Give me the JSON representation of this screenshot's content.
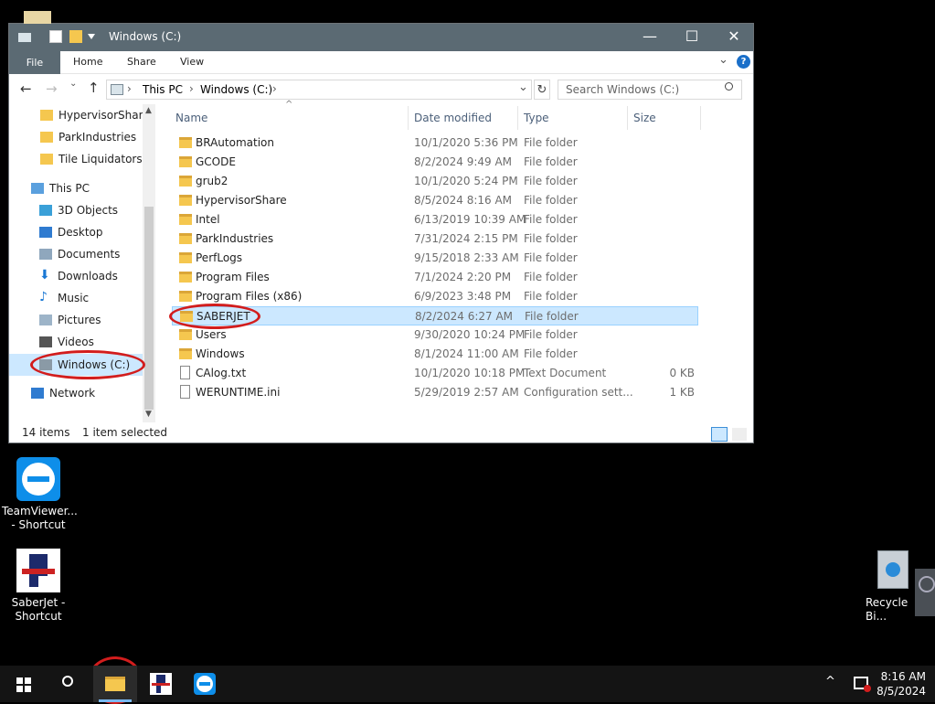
{
  "window": {
    "title": "Windows (C:)",
    "controls": {
      "minimize": "—",
      "maximize": "☐",
      "close": "✕"
    }
  },
  "ribbon": {
    "tabs": [
      "File",
      "Home",
      "Share",
      "View"
    ],
    "expand_chevron": "⌄",
    "help": "?"
  },
  "nav": {
    "back": "←",
    "forward": "→",
    "up": "↑",
    "breadcrumb": [
      "This PC",
      "Windows (C:)"
    ],
    "search_placeholder": "Search Windows (C:)"
  },
  "sidebar": {
    "quick_access": [
      "HypervisorShare",
      "ParkIndustries",
      "Tile Liquidators G"
    ],
    "this_pc": "This PC",
    "this_pc_items": [
      "3D Objects",
      "Desktop",
      "Documents",
      "Downloads",
      "Music",
      "Pictures",
      "Videos",
      "Windows (C:)"
    ],
    "network": "Network"
  },
  "file_list": {
    "columns": {
      "name": "Name",
      "date": "Date modified",
      "type": "Type",
      "size": "Size"
    },
    "rows": [
      {
        "name": "BRAutomation",
        "date": "10/1/2020 5:36 PM",
        "type": "File folder",
        "size": "",
        "icon": "folder-icon"
      },
      {
        "name": "GCODE",
        "date": "8/2/2024 9:49 AM",
        "type": "File folder",
        "size": "",
        "icon": "folder-icon"
      },
      {
        "name": "grub2",
        "date": "10/1/2020 5:24 PM",
        "type": "File folder",
        "size": "",
        "icon": "folder-icon"
      },
      {
        "name": "HypervisorShare",
        "date": "8/5/2024 8:16 AM",
        "type": "File folder",
        "size": "",
        "icon": "folder-icon"
      },
      {
        "name": "Intel",
        "date": "6/13/2019 10:39 AM",
        "type": "File folder",
        "size": "",
        "icon": "folder-icon"
      },
      {
        "name": "ParkIndustries",
        "date": "7/31/2024 2:15 PM",
        "type": "File folder",
        "size": "",
        "icon": "folder-icon"
      },
      {
        "name": "PerfLogs",
        "date": "9/15/2018 2:33 AM",
        "type": "File folder",
        "size": "",
        "icon": "folder-icon"
      },
      {
        "name": "Program Files",
        "date": "7/1/2024 2:20 PM",
        "type": "File folder",
        "size": "",
        "icon": "folder-icon"
      },
      {
        "name": "Program Files (x86)",
        "date": "6/9/2023 3:48 PM",
        "type": "File folder",
        "size": "",
        "icon": "folder-icon"
      },
      {
        "name": "SABERJET",
        "date": "8/2/2024 6:27 AM",
        "type": "File folder",
        "size": "",
        "icon": "folder-icon",
        "selected": true
      },
      {
        "name": "Users",
        "date": "9/30/2020 10:24 PM",
        "type": "File folder",
        "size": "",
        "icon": "folder-icon"
      },
      {
        "name": "Windows",
        "date": "8/1/2024 11:00 AM",
        "type": "File folder",
        "size": "",
        "icon": "folder-icon"
      },
      {
        "name": "CAlog.txt",
        "date": "10/1/2020 10:18 PM",
        "type": "Text Document",
        "size": "0 KB",
        "icon": "text-file-icon"
      },
      {
        "name": "WERUNTIME.ini",
        "date": "5/29/2019 2:57 AM",
        "type": "Configuration sett...",
        "size": "1 KB",
        "icon": "config-file-icon"
      }
    ]
  },
  "status": {
    "count": "14 items",
    "selection": "1 item selected"
  },
  "desktop": {
    "teamviewer": "TeamViewer... - Shortcut",
    "saberjet": "SaberJet - Shortcut",
    "recycle": "Recycle Bi..."
  },
  "taskbar": {
    "time": "8:16 AM",
    "date": "8/5/2024"
  },
  "colors": {
    "titlebar": "#5b6a73",
    "selection": "#cce8ff",
    "annotation": "#d21d1d",
    "folder": "#f5c74f"
  }
}
